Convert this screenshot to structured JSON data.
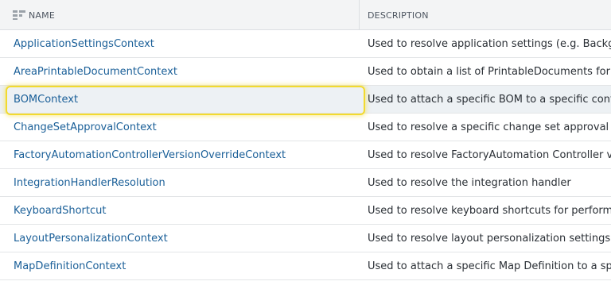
{
  "header": {
    "name_label": "NAME",
    "description_label": "DESCRIPTION",
    "columns_icon": "columns-icon"
  },
  "rows": [
    {
      "name": "ApplicationSettingsContext",
      "description": "Used to resolve application settings (e.g. Backgrou"
    },
    {
      "name": "AreaPrintableDocumentContext",
      "description": "Used to obtain a list of PrintableDocuments for a c"
    },
    {
      "name": "BOMContext",
      "description": "Used to attach a specific BOM to a specific context"
    },
    {
      "name": "ChangeSetApprovalContext",
      "description": "Used to resolve a specific change set approval work"
    },
    {
      "name": "FactoryAutomationControllerVersionOverrideContext",
      "description": "Used to resolve FactoryAutomation Controller vers"
    },
    {
      "name": "IntegrationHandlerResolution",
      "description": "Used to resolve the integration handler"
    },
    {
      "name": "KeyboardShortcut",
      "description": "Used to resolve keyboard shortcuts for performing"
    },
    {
      "name": "LayoutPersonalizationContext",
      "description": "Used to resolve layout personalization settings (e.g"
    },
    {
      "name": "MapDefinitionContext",
      "description": "Used to attach a specific Map Definition to a specif"
    }
  ],
  "highlighted_row": "BOMContext",
  "colors": {
    "link": "#1a5f98",
    "highlight_border": "#f2da2e",
    "header_bg": "#f3f4f5"
  }
}
